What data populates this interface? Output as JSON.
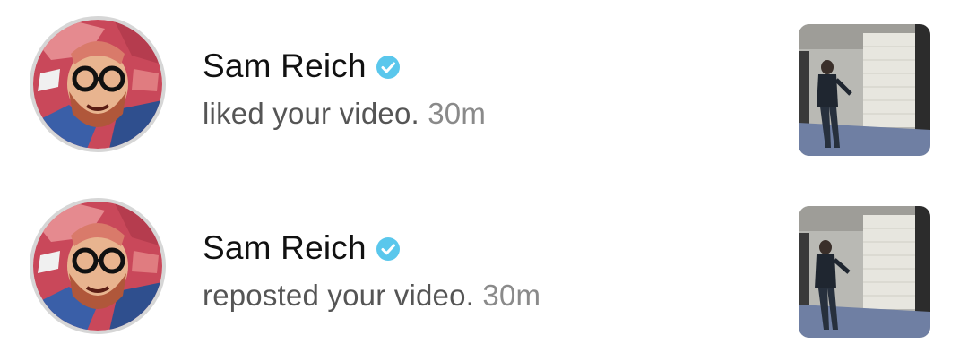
{
  "accent_verified": "#5ac7ec",
  "notifications": [
    {
      "user": "Sam Reich",
      "action": "liked your video.",
      "time": "30m",
      "avatar_icon": "illustrated-avatar-icon",
      "verified_icon": "verified-badge-icon",
      "thumbnail_icon": "video-thumbnail"
    },
    {
      "user": "Sam Reich",
      "action": "reposted your video.",
      "time": "30m",
      "avatar_icon": "illustrated-avatar-icon",
      "verified_icon": "verified-badge-icon",
      "thumbnail_icon": "video-thumbnail"
    }
  ]
}
